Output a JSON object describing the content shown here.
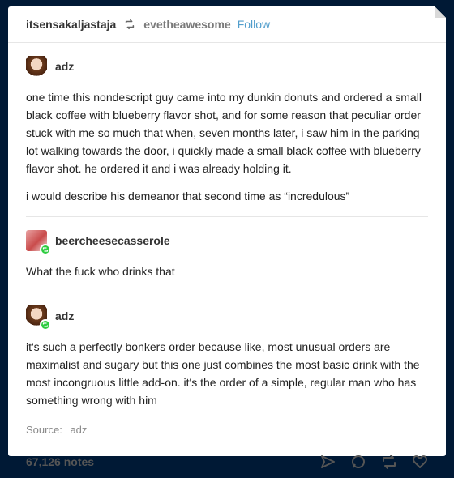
{
  "header": {
    "poster": "itsensakaljastaja",
    "reblog_icon": "reblog-icon",
    "source_blog": "evetheawesome",
    "follow_label": "Follow"
  },
  "posts": [
    {
      "author": "adz",
      "paragraphs": [
        "one time this nondescript guy came into my dunkin donuts and ordered a small black coffee with blueberry flavor shot, and for some reason that peculiar order stuck with me so much that when, seven months later, i saw him in the parking lot walking towards the door, i quickly made a small black coffee with blueberry flavor shot. he ordered it and i was already holding it.",
        "i would describe his demeanor that second time as “incredulous”"
      ]
    },
    {
      "author": "beercheesecasserole",
      "paragraphs": [
        "What the fuck who drinks that"
      ]
    },
    {
      "author": "adz",
      "paragraphs": [
        "it's such a perfectly bonkers order because like, most unusual orders are maximalist and sugary but this one just combines the most basic drink with the most incongruous little add-on. it's the order of a simple, regular man who has something wrong with him"
      ]
    }
  ],
  "source": {
    "label": "Source:",
    "value": "adz"
  },
  "footer": {
    "notes": "67,126 notes",
    "icons": [
      "share-icon",
      "reply-icon",
      "reblog-icon",
      "like-icon"
    ]
  }
}
